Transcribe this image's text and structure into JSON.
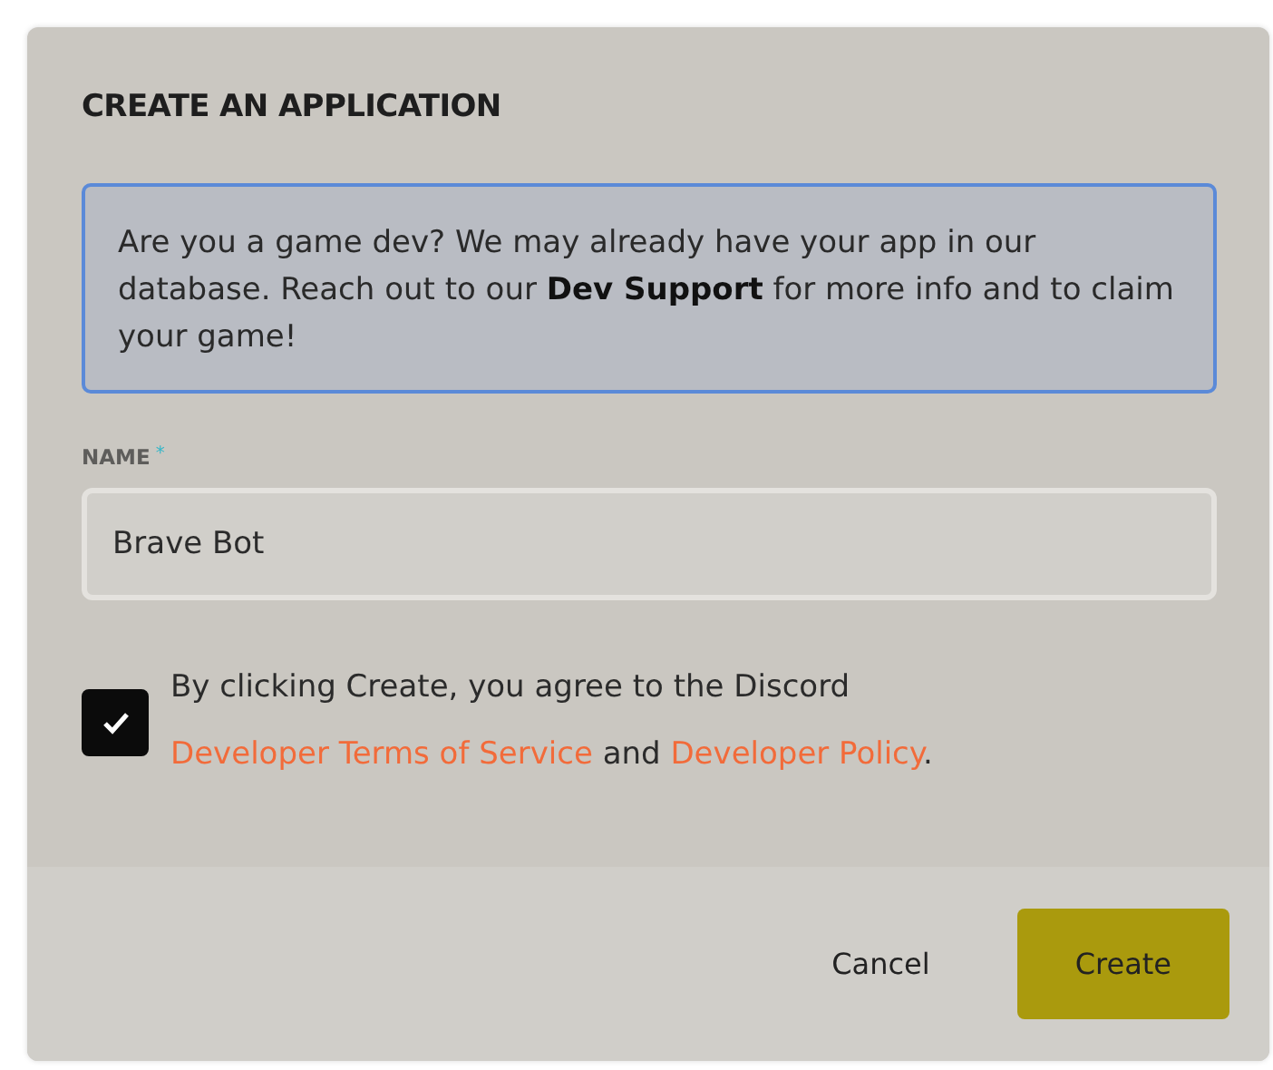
{
  "dialog": {
    "title": "CREATE AN APPLICATION",
    "notice": "Are you a game dev? We may already have your app in our database. Reach out to our **Dev Support** for more info and to claim your game!",
    "name_field": {
      "label": "NAME",
      "required_mark": "*",
      "value": "Brave Bot"
    },
    "agreement": {
      "checked": true,
      "parts": [
        {
          "kind": "text",
          "text": "By clicking Create, you agree to the Discord "
        },
        {
          "kind": "link",
          "text": "Developer Terms of Service"
        },
        {
          "kind": "text",
          "text": " and "
        },
        {
          "kind": "link",
          "text": "Developer Policy"
        },
        {
          "kind": "text",
          "text": "."
        }
      ]
    },
    "buttons": [
      {
        "kind": "secondary",
        "label": "Cancel"
      },
      {
        "kind": "primary",
        "label": "Create"
      }
    ]
  }
}
